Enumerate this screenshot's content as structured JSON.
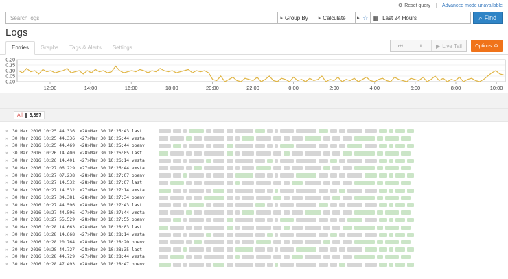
{
  "topbar": {
    "reset_label": "Reset query",
    "advanced_label": "Advanced mode unavailable"
  },
  "search": {
    "placeholder": "Search logs",
    "groupby_label": "Group By",
    "calculate_label": "Calculate",
    "date_range": "Last 24 Hours",
    "find_label": "Find"
  },
  "page": {
    "title": "Logs"
  },
  "tabs": [
    {
      "label": "Entries",
      "active": true
    },
    {
      "label": "Graphs"
    },
    {
      "label": "Tags & Alerts"
    },
    {
      "label": "Settings"
    }
  ],
  "controls": {
    "live_tail_label": "Live Tail",
    "options_label": "Options"
  },
  "chart_data": {
    "type": "line",
    "yticks": [
      "0.20",
      "0.15",
      "0.10",
      "0.05",
      "0.00"
    ],
    "ylim": [
      0,
      0.2
    ],
    "xticks": [
      "12:00",
      "14:00",
      "16:00",
      "18:00",
      "20:00",
      "22:00",
      "0:00",
      "2:00",
      "4:00",
      "6:00",
      "8:00",
      "10:00"
    ],
    "color": "#e0b545",
    "series": [
      {
        "values": [
          0.1,
          0.08,
          0.12,
          0.09,
          0.1,
          0.07,
          0.11,
          0.09,
          0.1,
          0.08,
          0.09,
          0.1,
          0.12,
          0.08,
          0.09,
          0.1,
          0.07,
          0.1,
          0.08,
          0.11,
          0.09,
          0.1,
          0.08,
          0.09,
          0.14,
          0.1,
          0.08,
          0.09,
          0.1,
          0.09,
          0.11,
          0.1,
          0.08,
          0.1,
          0.09,
          0.12,
          0.1,
          0.09,
          0.1,
          0.08,
          0.09,
          0.1,
          0.11,
          0.08,
          0.1,
          0.09,
          0.1,
          0.08,
          0.02,
          0.01,
          0.05,
          0.0,
          0.02,
          0.04,
          0.01,
          0.0,
          0.03,
          0.02,
          0.01,
          0.04,
          0.0,
          0.02,
          0.05,
          0.01,
          0.0,
          0.03,
          0.02,
          0.0,
          0.04,
          0.01,
          0.02,
          0.0,
          0.03,
          0.01,
          0.02,
          0.05,
          0.0,
          0.02,
          0.01,
          0.04,
          0.0,
          0.02,
          0.01,
          0.03,
          0.0,
          0.02,
          0.04,
          0.01,
          0.0,
          0.02,
          0.03,
          0.01,
          0.0,
          0.04,
          0.02,
          0.01,
          0.0,
          0.03,
          0.02,
          0.01,
          0.04,
          0.0,
          0.02,
          0.05,
          0.01,
          0.03,
          0.0,
          0.02,
          0.01,
          0.04,
          0.0,
          0.02,
          0.03,
          0.01,
          0.0,
          0.02,
          0.05,
          0.08,
          0.1,
          0.07,
          0.06
        ]
      }
    ]
  },
  "counter": {
    "all_label": "All",
    "count": "3,397"
  },
  "logs": [
    {
      "ts": "30 Mar 2016 10:25:44.336",
      "msg": "<28>Mar 30 10:25:43 last"
    },
    {
      "ts": "30 Mar 2016 10:25:44.336",
      "msg": "<27>Mar 30 10:25:44 vmsta"
    },
    {
      "ts": "30 Mar 2016 10:25:44.469",
      "msg": "<28>Mar 30 10:25:44 openv"
    },
    {
      "ts": "30 Mar 2016 10:26:14.400",
      "msg": "<28>Mar 30 10:26:05 last"
    },
    {
      "ts": "30 Mar 2016 10:26:14.401",
      "msg": "<27>Mar 30 10:26:14 vmsta"
    },
    {
      "ts": "30 Mar 2016 10:27:06.229",
      "msg": "<27>Mar 30 10:26:44 vmsta"
    },
    {
      "ts": "30 Mar 2016 10:27:07.238",
      "msg": "<28>Mar 30 10:27:07 openv"
    },
    {
      "ts": "30 Mar 2016 10:27:14.532",
      "msg": "<28>Mar 30 10:27:07 last"
    },
    {
      "ts": "30 Mar 2016 10:27:14.532",
      "msg": "<27>Mar 30 10:27:14 vmsta"
    },
    {
      "ts": "30 Mar 2016 10:27:34.381",
      "msg": "<28>Mar 30 10:27:34 openv"
    },
    {
      "ts": "30 Mar 2016 10:27:44.596",
      "msg": "<28>Mar 30 10:27:43 last"
    },
    {
      "ts": "30 Mar 2016 10:27:44.596",
      "msg": "<27>Mar 30 10:27:44 vmsta"
    },
    {
      "ts": "30 Mar 2016 10:27:55.529",
      "msg": "<28>Mar 30 10:27:55 openv"
    },
    {
      "ts": "30 Mar 2016 10:28:14.663",
      "msg": "<28>Mar 30 10:28:03 last"
    },
    {
      "ts": "30 Mar 2016 10:28:14.668",
      "msg": "<27>Mar 30 10:28:14 vmsta"
    },
    {
      "ts": "30 Mar 2016 10:28:20.764",
      "msg": "<28>Mar 30 10:28:20 openv"
    },
    {
      "ts": "30 Mar 2016 10:28:44.727",
      "msg": "<28>Mar 30 10:28:35 last"
    },
    {
      "ts": "30 Mar 2016 10:28:44.729",
      "msg": "<27>Mar 30 10:28:44 vmsta"
    },
    {
      "ts": "30 Mar 2016 10:28:47.493",
      "msg": "<28>Mar 30 10:28:47 openv"
    }
  ]
}
